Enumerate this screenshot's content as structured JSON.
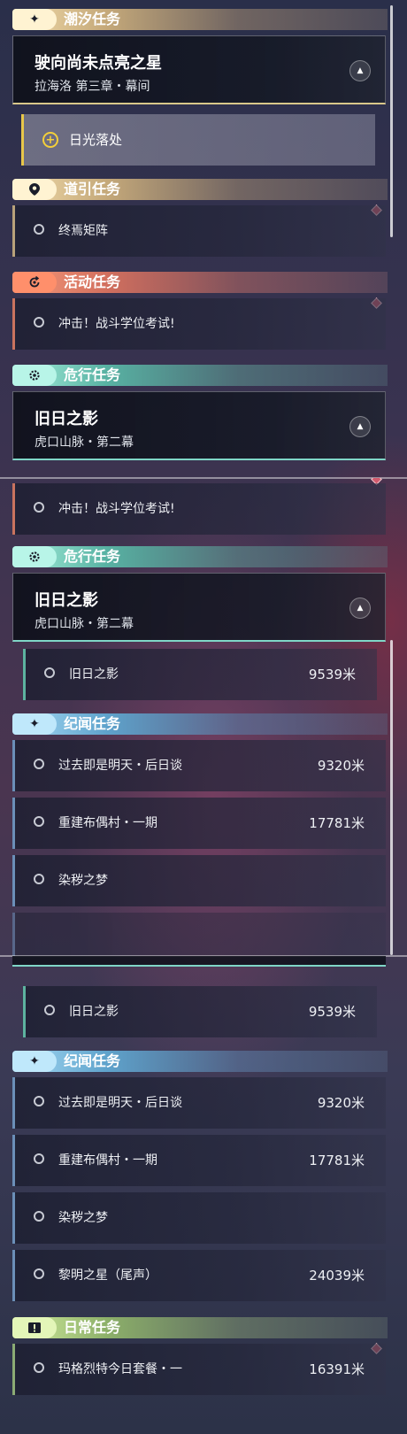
{
  "panels": [
    {
      "sections": [
        {
          "title": "潮汐任务",
          "icon": "four-point-star-icon"
        },
        {
          "title": "道引任务",
          "icon": "map-pin-icon"
        },
        {
          "title": "活动任务",
          "icon": "event-refresh-icon"
        },
        {
          "title": "危行任务",
          "icon": "danger-gear-icon"
        }
      ],
      "features": [
        {
          "title": "驶向尚未点亮之星",
          "subtitle": "拉海洛 第三章・幕间"
        },
        {
          "title": "旧日之影",
          "subtitle": "虎口山脉・第二幕"
        }
      ],
      "gold_sub": {
        "label": "日光落处"
      },
      "rows": [
        {
          "label": "终焉矩阵"
        },
        {
          "label": "冲击！战斗学位考试!"
        }
      ]
    },
    {
      "sections": [
        {
          "title": "危行任务",
          "icon": "danger-gear-icon"
        },
        {
          "title": "纪闻任务",
          "icon": "four-point-star-icon"
        }
      ],
      "features": [
        {
          "title": "旧日之影",
          "subtitle": "虎口山脉・第二幕"
        }
      ],
      "rows": [
        {
          "label": "冲击！战斗学位考试!"
        },
        {
          "label": "旧日之影",
          "distance": "9539米"
        },
        {
          "label": "过去即是明天・后日谈",
          "distance": "9320米"
        },
        {
          "label": "重建布偶村・一期",
          "distance": "17781米"
        },
        {
          "label": "染秽之梦"
        }
      ]
    },
    {
      "sections": [
        {
          "title": "纪闻任务",
          "icon": "four-point-star-icon"
        },
        {
          "title": "日常任务",
          "icon": "exclamation-box-icon"
        }
      ],
      "rows": [
        {
          "label": "旧日之影",
          "distance": "9539米"
        },
        {
          "label": "过去即是明天・后日谈",
          "distance": "9320米"
        },
        {
          "label": "重建布偶村・一期",
          "distance": "17781米"
        },
        {
          "label": "染秽之梦"
        },
        {
          "label": "黎明之星（尾声）",
          "distance": "24039米"
        },
        {
          "label": "玛格烈特今日套餐・一",
          "distance": "16391米"
        }
      ]
    }
  ],
  "colors": {
    "tide": "#f2dcab",
    "guide": "#f2dcab",
    "event": "#f59a7a",
    "danger": "#a7f0dd",
    "chronicle": "#a8dcf5",
    "daily": "#d4ef9f",
    "track_marker": "#d25b6e",
    "gold_accent": "#f3cf3a"
  }
}
